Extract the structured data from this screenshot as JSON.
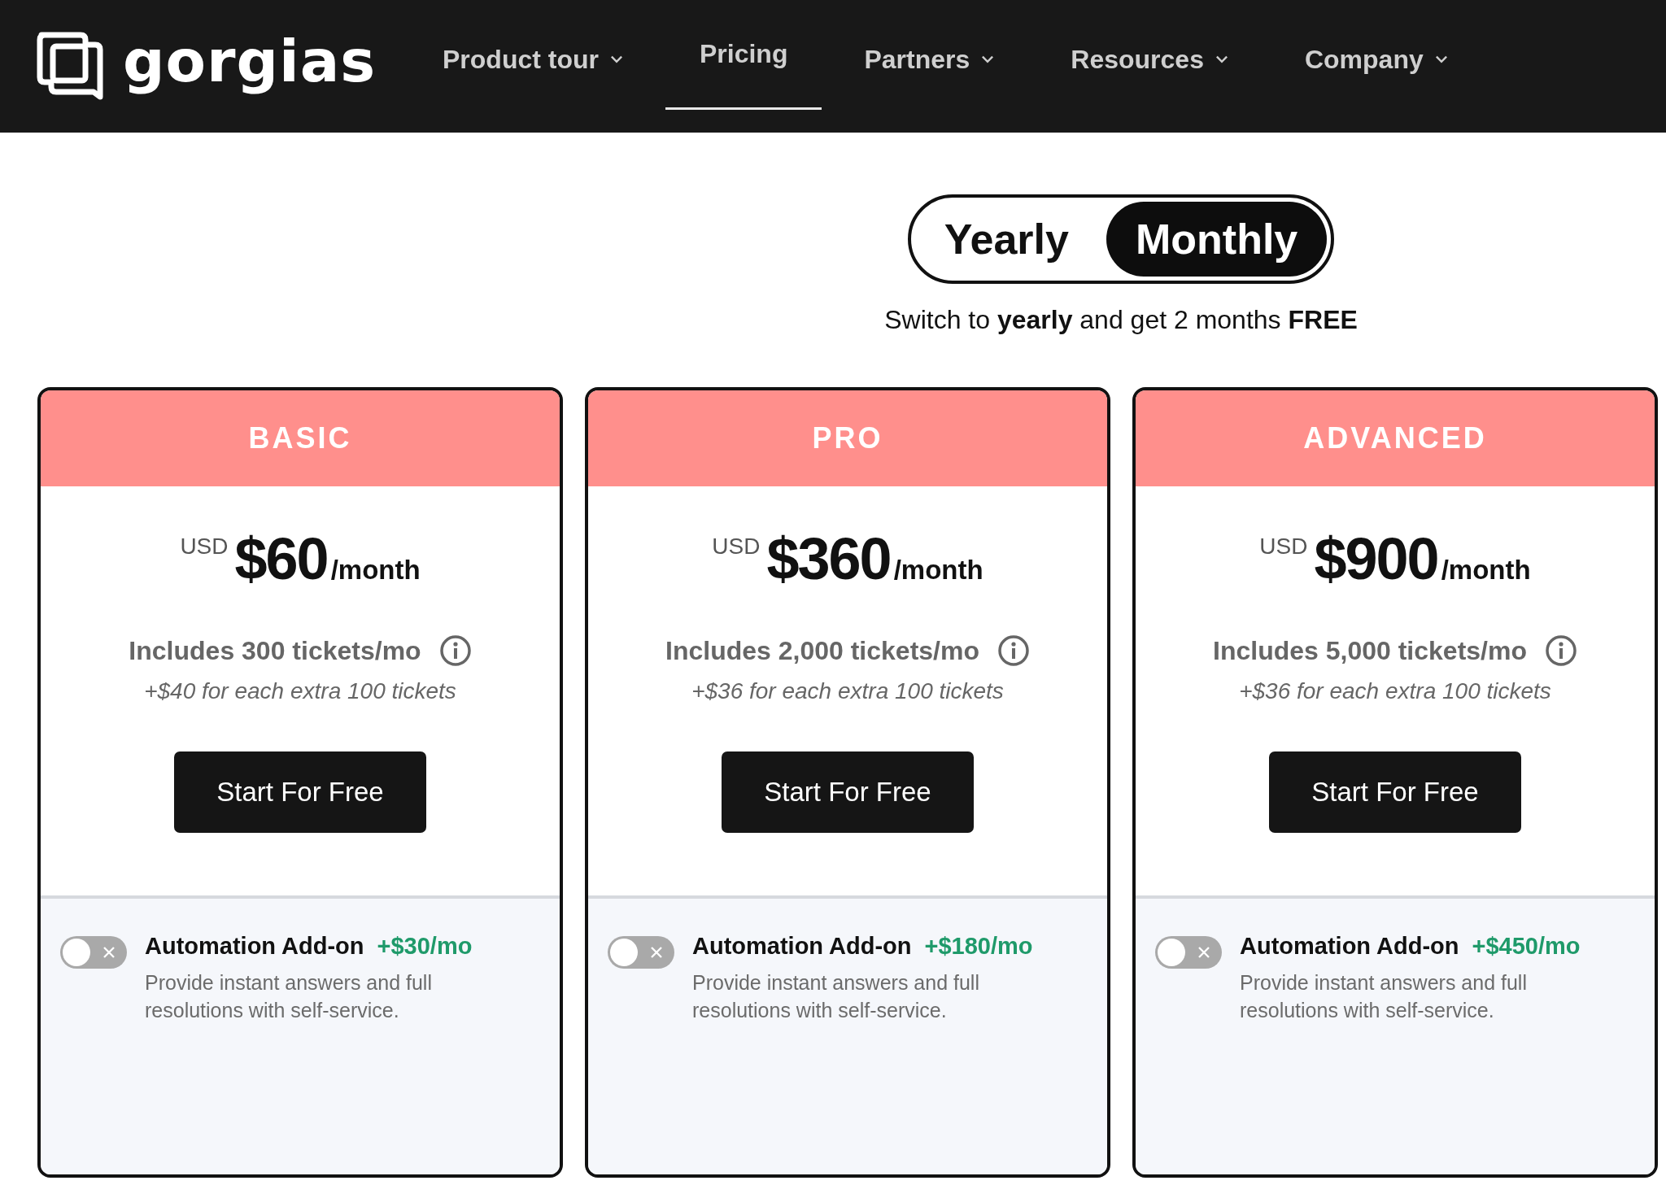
{
  "header": {
    "logo": "gorgias",
    "nav": [
      {
        "label": "Product tour",
        "dropdown": true,
        "selected": false
      },
      {
        "label": "Pricing",
        "dropdown": false,
        "selected": true
      },
      {
        "label": "Partners",
        "dropdown": true,
        "selected": false
      },
      {
        "label": "Resources",
        "dropdown": true,
        "selected": false
      },
      {
        "label": "Company",
        "dropdown": true,
        "selected": false
      }
    ]
  },
  "billing": {
    "options": [
      {
        "label": "Yearly",
        "selected": false
      },
      {
        "label": "Monthly",
        "selected": true
      }
    ],
    "note": "Switch to **yearly** and get 2 months **FREE**"
  },
  "plans": [
    {
      "name": "BASIC",
      "currency": "USD",
      "price": "$60",
      "period": "/month",
      "tickets": "Includes 300 tickets/mo",
      "extra": "+$40 for each extra 100 tickets",
      "cta": "Start For Free",
      "addon": {
        "title": "Automation Add-on",
        "price": "+$30/mo",
        "description": "Provide instant answers and full resolutions with self-service.",
        "on": false
      }
    },
    {
      "name": "PRO",
      "currency": "USD",
      "price": "$360",
      "period": "/month",
      "tickets": "Includes 2,000 tickets/mo",
      "extra": "+$36 for each extra 100 tickets",
      "cta": "Start For Free",
      "addon": {
        "title": "Automation Add-on",
        "price": "+$180/mo",
        "description": "Provide instant answers and full resolutions with self-service.",
        "on": false
      }
    },
    {
      "name": "ADVANCED",
      "currency": "USD",
      "price": "$900",
      "period": "/month",
      "tickets": "Includes 5,000 tickets/mo",
      "extra": "+$36 for each extra 100 tickets",
      "cta": "Start For Free",
      "addon": {
        "title": "Automation Add-on",
        "price": "+$450/mo",
        "description": "Provide instant answers and full resolutions with self-service.",
        "on": false
      }
    }
  ]
}
